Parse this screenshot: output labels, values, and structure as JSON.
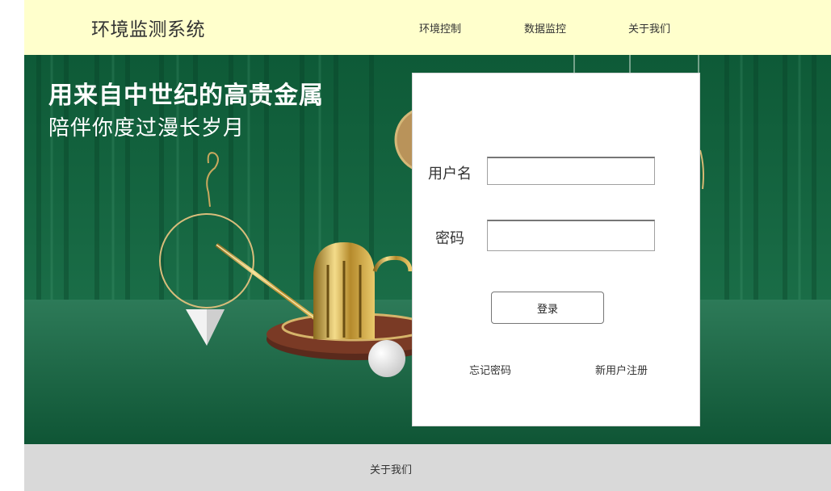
{
  "header": {
    "brand": "环境监测系统",
    "nav": [
      "环境控制",
      "数据监控",
      "关于我们"
    ]
  },
  "hero": {
    "headline": "用来自中世纪的高贵金属",
    "subheadline": "陪伴你度过漫长岁月"
  },
  "login": {
    "username_label": "用户名",
    "username_value": "",
    "password_label": "密码",
    "password_value": "",
    "submit_label": "登录",
    "forgot_label": "忘记密码",
    "register_label": "新用户注册"
  },
  "footer": {
    "about_label": "关于我们"
  },
  "colors": {
    "topbar_bg": "#ffffcc",
    "hero_green": "#1b6a46",
    "footer_bg": "#d9d9d9"
  }
}
